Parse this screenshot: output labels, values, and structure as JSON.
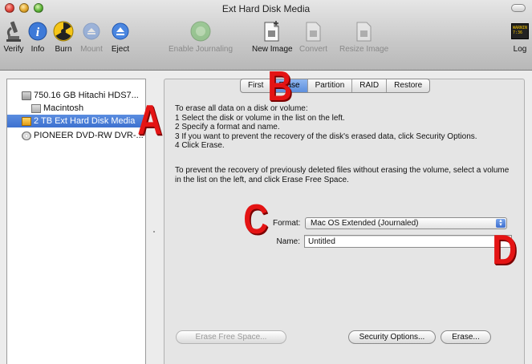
{
  "window": {
    "title": "Ext Hard Disk Media"
  },
  "toolbar": {
    "items": [
      {
        "label": "Verify",
        "icon": "microscope-icon",
        "enabled": true
      },
      {
        "label": "Info",
        "icon": "info-icon",
        "enabled": true
      },
      {
        "label": "Burn",
        "icon": "burn-icon",
        "enabled": true
      },
      {
        "label": "Mount",
        "icon": "mount-icon",
        "enabled": false
      },
      {
        "label": "Eject",
        "icon": "eject-icon",
        "enabled": true
      },
      {
        "label": "Enable Journaling",
        "icon": "journaling-icon",
        "enabled": false
      },
      {
        "label": "New Image",
        "icon": "new-image-icon",
        "enabled": true
      },
      {
        "label": "Convert",
        "icon": "convert-icon",
        "enabled": false
      },
      {
        "label": "Resize Image",
        "icon": "resize-image-icon",
        "enabled": false
      },
      {
        "label": "Log",
        "icon": "log-icon",
        "enabled": true
      }
    ],
    "log_icon_text": "WARNIN\n7:36"
  },
  "sidebar": {
    "items": [
      {
        "label": "750.16 GB Hitachi HDS7...",
        "icon": "hard-drive-icon",
        "selected": false
      },
      {
        "label": "Macintosh",
        "icon": "volume-icon",
        "selected": false
      },
      {
        "label": "2 TB Ext Hard Disk Media",
        "icon": "external-drive-icon",
        "selected": true
      },
      {
        "label": "PIONEER DVD-RW DVR-...",
        "icon": "dvd-drive-icon",
        "selected": false
      }
    ]
  },
  "tabs": [
    {
      "label": "First",
      "active": false
    },
    {
      "label": "Erase",
      "active": true
    },
    {
      "label": "Partition",
      "active": false
    },
    {
      "label": "RAID",
      "active": false
    },
    {
      "label": "Restore",
      "active": false
    }
  ],
  "erase": {
    "instructions": "To erase all data on a disk or volume:\n1 Select the disk or volume in the list on the left.\n2 Specify a format and name.\n3 If you want to prevent the recovery of the disk's erased data, click Security Options.\n4 Click Erase.",
    "free_space_note": "To prevent the recovery of previously deleted files without erasing the volume, select a volume in the list on the left, and click Erase Free Space.",
    "format_label": "Format:",
    "format_value": "Mac OS Extended (Journaled)",
    "name_label": "Name:",
    "name_value": "Untitled",
    "erase_free_space_button": "Erase Free Space...",
    "security_options_button": "Security Options...",
    "erase_button": "Erase..."
  },
  "callouts": {
    "a": "A",
    "b": "B",
    "c": "C",
    "d": "D"
  },
  "colors": {
    "selection": "#3d71cf",
    "callout": "#e41414"
  }
}
